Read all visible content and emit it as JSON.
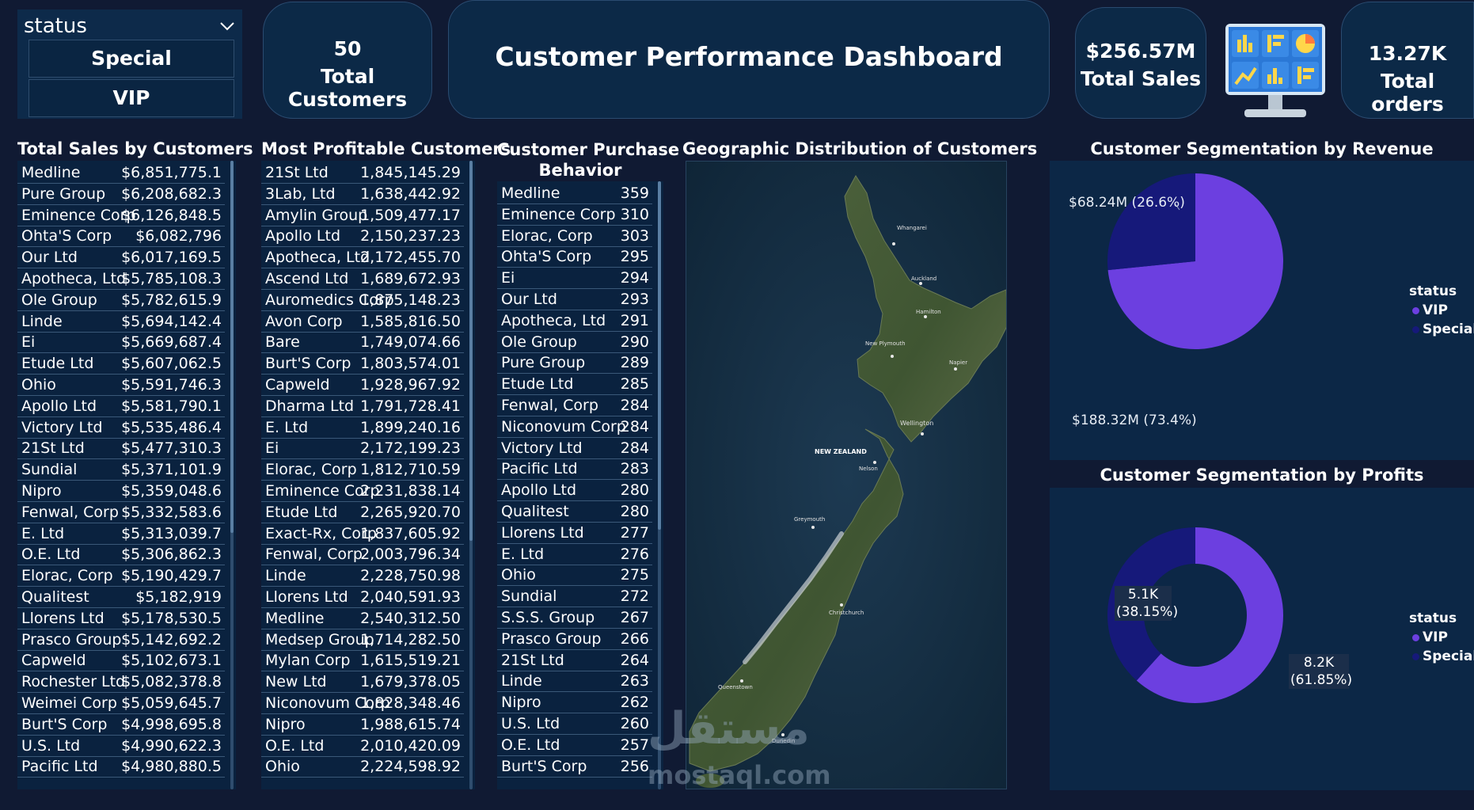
{
  "slicer": {
    "label": "status",
    "options": [
      "Special",
      "VIP"
    ]
  },
  "kpi": {
    "customers_value": "50",
    "customers_label": "Total Customers",
    "sales_value": "$256.57M",
    "sales_label": "Total Sales",
    "orders_value": "13.27K",
    "orders_label": "Total orders"
  },
  "dashboard_title": "Customer Performance Dashboard",
  "sales_table": {
    "title": "Total Sales by Customers",
    "rows": [
      [
        "Medline",
        "$6,851,775.1"
      ],
      [
        "Pure Group",
        "$6,208,682.3"
      ],
      [
        "Eminence Corp",
        "$6,126,848.5"
      ],
      [
        "Ohta'S Corp",
        "$6,082,796"
      ],
      [
        "Our Ltd",
        "$6,017,169.5"
      ],
      [
        "Apotheca, Ltd",
        "$5,785,108.3"
      ],
      [
        "Ole Group",
        "$5,782,615.9"
      ],
      [
        "Linde",
        "$5,694,142.4"
      ],
      [
        "Ei",
        "$5,669,687.4"
      ],
      [
        "Etude Ltd",
        "$5,607,062.5"
      ],
      [
        "Ohio",
        "$5,591,746.3"
      ],
      [
        "Apollo Ltd",
        "$5,581,790.1"
      ],
      [
        "Victory Ltd",
        "$5,535,486.4"
      ],
      [
        "21St Ltd",
        "$5,477,310.3"
      ],
      [
        "Sundial",
        "$5,371,101.9"
      ],
      [
        "Nipro",
        "$5,359,048.6"
      ],
      [
        "Fenwal, Corp",
        "$5,332,583.6"
      ],
      [
        "E. Ltd",
        "$5,313,039.7"
      ],
      [
        "O.E. Ltd",
        "$5,306,862.3"
      ],
      [
        "Elorac, Corp",
        "$5,190,429.7"
      ],
      [
        "Qualitest",
        "$5,182,919"
      ],
      [
        "Llorens Ltd",
        "$5,178,530.5"
      ],
      [
        "Prasco Group",
        "$5,142,692.2"
      ],
      [
        "Capweld",
        "$5,102,673.1"
      ],
      [
        "Rochester Ltd",
        "$5,082,378.8"
      ],
      [
        "Weimei Corp",
        "$5,059,645.7"
      ],
      [
        "Burt'S Corp",
        "$4,998,695.8"
      ],
      [
        "U.S. Ltd",
        "$4,990,622.3"
      ],
      [
        "Pacific Ltd",
        "$4,980,880.5"
      ]
    ]
  },
  "profit_table": {
    "title": "Most Profitable Customers",
    "rows": [
      [
        "21St Ltd",
        "1,845,145.29"
      ],
      [
        "3Lab, Ltd",
        "1,638,442.92"
      ],
      [
        "Amylin Group",
        "1,509,477.17"
      ],
      [
        "Apollo Ltd",
        "2,150,237.23"
      ],
      [
        "Apotheca, Ltd",
        "2,172,455.70"
      ],
      [
        "Ascend Ltd",
        "1,689,672.93"
      ],
      [
        "Auromedics Corp",
        "1,875,148.23"
      ],
      [
        "Avon Corp",
        "1,585,816.50"
      ],
      [
        "Bare",
        "1,749,074.66"
      ],
      [
        "Burt'S Corp",
        "1,803,574.01"
      ],
      [
        "Capweld",
        "1,928,967.92"
      ],
      [
        "Dharma Ltd",
        "1,791,728.41"
      ],
      [
        "E. Ltd",
        "1,899,240.16"
      ],
      [
        "Ei",
        "2,172,199.23"
      ],
      [
        "Elorac, Corp",
        "1,812,710.59"
      ],
      [
        "Eminence Corp",
        "2,231,838.14"
      ],
      [
        "Etude Ltd",
        "2,265,920.70"
      ],
      [
        "Exact-Rx, Corp",
        "1,837,605.92"
      ],
      [
        "Fenwal, Corp",
        "2,003,796.34"
      ],
      [
        "Linde",
        "2,228,750.98"
      ],
      [
        "Llorens Ltd",
        "2,040,591.93"
      ],
      [
        "Medline",
        "2,540,312.50"
      ],
      [
        "Medsep Group",
        "1,714,282.50"
      ],
      [
        "Mylan Corp",
        "1,615,519.21"
      ],
      [
        "New Ltd",
        "1,679,378.05"
      ],
      [
        "Niconovum Corp",
        "1,828,348.46"
      ],
      [
        "Nipro",
        "1,988,615.74"
      ],
      [
        "O.E. Ltd",
        "2,010,420.09"
      ],
      [
        "Ohio",
        "2,224,598.92"
      ]
    ]
  },
  "purchase_table": {
    "title_line1": "Customer Purchase",
    "title_line2": "Behavior",
    "rows": [
      [
        "Medline",
        "359"
      ],
      [
        "Eminence Corp",
        "310"
      ],
      [
        "Elorac, Corp",
        "303"
      ],
      [
        "Ohta'S Corp",
        "295"
      ],
      [
        "Ei",
        "294"
      ],
      [
        "Our Ltd",
        "293"
      ],
      [
        "Apotheca, Ltd",
        "291"
      ],
      [
        "Ole Group",
        "290"
      ],
      [
        "Pure Group",
        "289"
      ],
      [
        "Etude Ltd",
        "285"
      ],
      [
        "Fenwal, Corp",
        "284"
      ],
      [
        "Niconovum Corp",
        "284"
      ],
      [
        "Victory Ltd",
        "284"
      ],
      [
        "Pacific Ltd",
        "283"
      ],
      [
        "Apollo Ltd",
        "280"
      ],
      [
        "Qualitest",
        "280"
      ],
      [
        "Llorens Ltd",
        "277"
      ],
      [
        "E. Ltd",
        "276"
      ],
      [
        "Ohio",
        "275"
      ],
      [
        "Sundial",
        "272"
      ],
      [
        "S.S.S. Group",
        "267"
      ],
      [
        "Prasco Group",
        "266"
      ],
      [
        "21St Ltd",
        "264"
      ],
      [
        "Linde",
        "263"
      ],
      [
        "Nipro",
        "262"
      ],
      [
        "U.S. Ltd",
        "260"
      ],
      [
        "O.E. Ltd",
        "257"
      ],
      [
        "Burt'S Corp",
        "256"
      ]
    ]
  },
  "map": {
    "title": "Geographic Distribution of Customers",
    "country_label": "NEW ZEALAND",
    "cities": [
      "Whangarei",
      "Auckland",
      "Hamilton",
      "New Plymouth",
      "Napier",
      "Wellington",
      "Nelson",
      "Greymouth",
      "Christchurch",
      "Queenstown",
      "Dunedin"
    ]
  },
  "revenue_segmentation": {
    "title": "Customer Segmentation by Revenue",
    "label_special": "$68.24M (26.6%)",
    "label_vip": "$188.32M (73.4%)",
    "legend_title": "status",
    "legend_vip": "VIP",
    "legend_special": "Special"
  },
  "profit_segmentation": {
    "title": "Customer Segmentation by Profits",
    "label_special_value": "5.1K",
    "label_special_pct": "(38.15%)",
    "label_vip_value": "8.2K",
    "label_vip_pct": "(61.85%)",
    "legend_title": "status",
    "legend_vip": "VIP",
    "legend_special": "Special"
  },
  "chart_data": [
    {
      "type": "pie",
      "title": "Customer Segmentation by Revenue",
      "categories": [
        "VIP",
        "Special"
      ],
      "values": [
        188.32,
        68.24
      ],
      "percent": [
        73.4,
        26.6
      ],
      "legend": "right"
    },
    {
      "type": "pie",
      "title": "Customer Segmentation by Profits",
      "categories": [
        "VIP",
        "Special"
      ],
      "values": [
        8200,
        5100
      ],
      "percent": [
        61.85,
        38.15
      ],
      "legend": "right"
    }
  ],
  "colors": {
    "vip": "#6c3fe0",
    "special": "#16197a",
    "background": "#101a33",
    "panel": "#0c2746"
  },
  "icons": [
    "chevron-down-icon",
    "dashboard-monitor-icon"
  ],
  "watermark": {
    "arabic": "مستقل",
    "latin": "mostaql.com"
  }
}
